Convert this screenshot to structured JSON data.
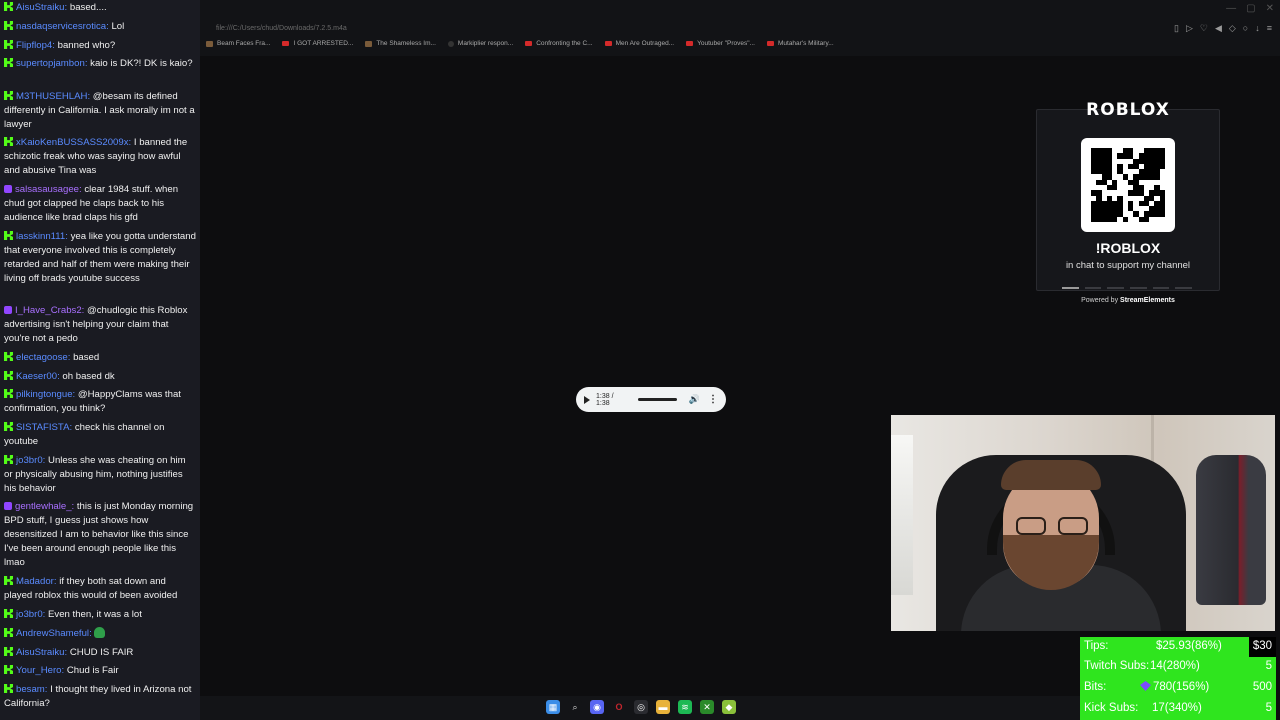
{
  "browser": {
    "address": "file:///C:/Users/chud/Downloads/7.2.5.m4a",
    "bookmarks": [
      {
        "label": "Beam Faces Fra...",
        "icon": "generic"
      },
      {
        "label": "I GOT ARRESTED...",
        "icon": "youtube"
      },
      {
        "label": "The Shameless Im...",
        "icon": "generic"
      },
      {
        "label": "Markiplier respon...",
        "icon": "dot"
      },
      {
        "label": "Confronting the C...",
        "icon": "youtube"
      },
      {
        "label": "Men Are Outraged...",
        "icon": "youtube"
      },
      {
        "label": "Youtuber \"Proves\"...",
        "icon": "youtube"
      },
      {
        "label": "Mutahar's Military...",
        "icon": "youtube"
      }
    ]
  },
  "chat": {
    "messages": [
      {
        "badge": "kick",
        "user": "AisuStraiku",
        "text": "based...."
      },
      {
        "badge": "kick",
        "user": "nasdaqservicesrotica",
        "text": "Lol"
      },
      {
        "badge": "kick",
        "user": "Flipflop4",
        "text": "banned who?"
      },
      {
        "badge": "kick",
        "user": "supertopjambon",
        "text": "kaio is DK?! DK is kaio?"
      },
      {
        "badge": "kick",
        "user": "M3THUSEHLAH",
        "text": "@besam its defined differently in California. I ask morally im not a lawyer"
      },
      {
        "badge": "kick",
        "user": "xKaioKenBUSSASS2009x",
        "text": "I banned the schizotic freak who was saying how awful and abusive Tina was"
      },
      {
        "badge": "twitch",
        "user": "salsasausagee",
        "text": "clear 1984 stuff. when chud got clapped he claps back to his audience like brad claps his gfd"
      },
      {
        "badge": "kick",
        "user": "lasskinn111",
        "text": "yea like you gotta understand that everyone involved this is completely retarded and half of them were making their living off brads youtube success"
      },
      {
        "badge": "twitch",
        "user": "I_Have_Crabs2",
        "text": "@chudlogic this Roblox advertising isn't helping your claim that you're not a pedo"
      },
      {
        "badge": "kick",
        "user": "electagoose",
        "text": "based"
      },
      {
        "badge": "kick",
        "user": "Kaeser00",
        "text": "oh based dk"
      },
      {
        "badge": "kick",
        "user": "pilkingtongue",
        "text": "@HappyClams was that confirmation, you think?"
      },
      {
        "badge": "kick",
        "user": "SISTAFISTA",
        "text": "check his channel on youtube"
      },
      {
        "badge": "kick",
        "user": "jo3br0",
        "text": "Unless she was cheating on him or physically abusing him, nothing justifies his behavior"
      },
      {
        "badge": "twitch",
        "user": "gentlewhale_",
        "text": "this is just Monday morning BPD stuff, I guess just shows how desensitized I am to behavior like this since I've been around enough people like this lmao"
      },
      {
        "badge": "kick",
        "user": "Madador",
        "text": "if they both sat down and played roblox this would of been avoided"
      },
      {
        "badge": "kick",
        "user": "jo3br0",
        "text": "Even then, it was a lot"
      },
      {
        "badge": "kick",
        "user": "AndrewShameful",
        "text": "",
        "emote": "green-emote"
      },
      {
        "badge": "kick",
        "user": "AisuStraiku",
        "text": "CHUD IS FAIR"
      },
      {
        "badge": "kick",
        "user": "Your_Hero",
        "text": "Chud is Fair"
      },
      {
        "badge": "kick",
        "user": "besam",
        "text": "I thought they lived in Arizona not California?"
      }
    ]
  },
  "roblox": {
    "logo": "ROBLOX",
    "command": "!ROBLOX",
    "subtitle": "in chat to support my channel",
    "powered_prefix": "Powered by",
    "powered_brand": "StreamElements"
  },
  "player": {
    "time": "1:38 / 1:38",
    "progress": 1.0
  },
  "goals": [
    {
      "label": "Tips:",
      "value": "$25.93(86%)",
      "target": "$30",
      "fraction": 0.86
    },
    {
      "label": "Twitch Subs:",
      "value": "14(280%)",
      "target": "5",
      "fraction": 1.0
    },
    {
      "label": "Bits:",
      "value": "780(156%)",
      "target": "500",
      "fraction": 1.0
    },
    {
      "label": "Kick Subs:",
      "value": "17(340%)",
      "target": "5",
      "fraction": 1.0
    }
  ],
  "colors": {
    "kick": "#53fc18",
    "twitch": "#9146ff",
    "goal_green": "#2fe51e",
    "chat_bg": "#1a1b22"
  },
  "taskbar": {
    "icons": [
      "windows-start-icon",
      "search-icon",
      "discord-icon",
      "opera-icon",
      "chrome-icon",
      "file-explorer-icon",
      "spotify-icon",
      "xbox-icon",
      "app-icon"
    ]
  }
}
